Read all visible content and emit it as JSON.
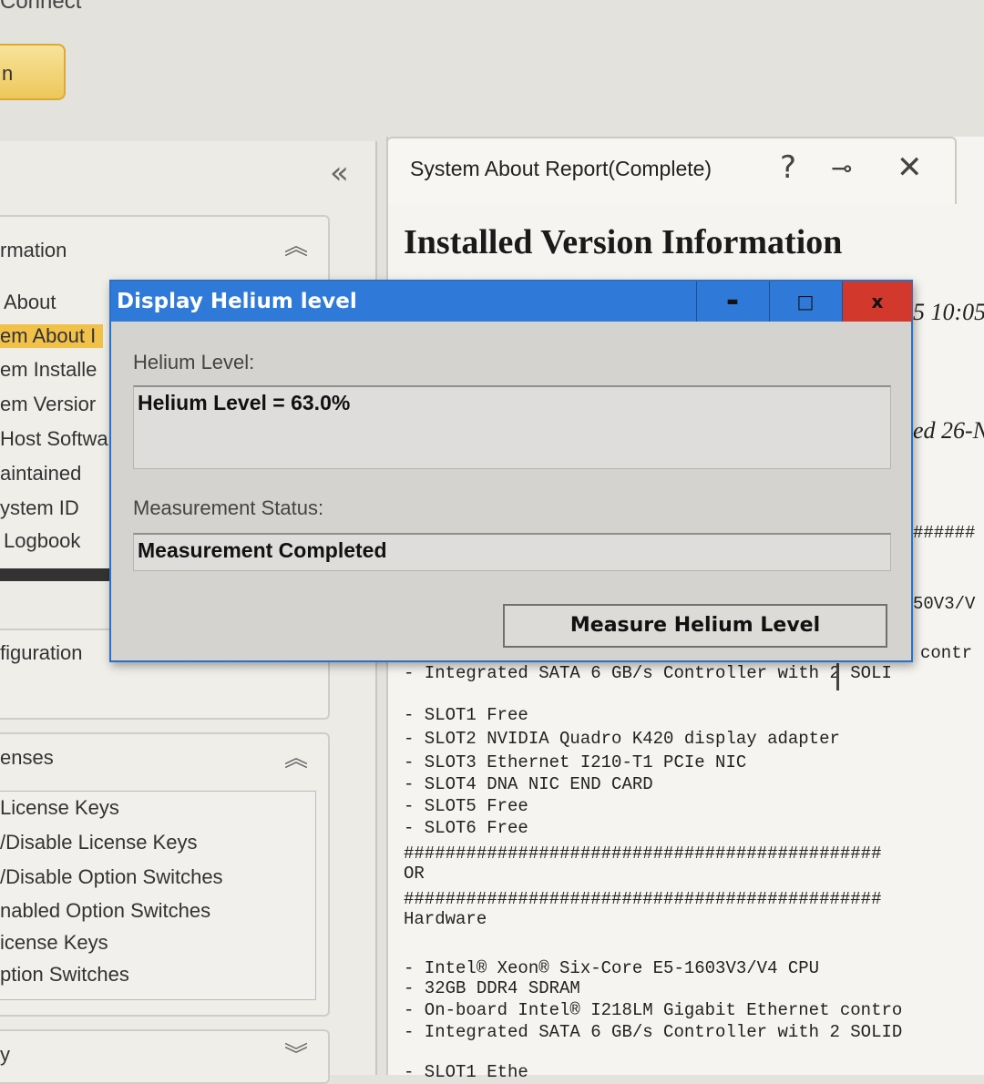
{
  "app": {
    "title": "Connect",
    "top_button_label": "n"
  },
  "sidebar": {
    "collapse_glyph": "«",
    "info_group": {
      "title": "rmation",
      "items": [
        {
          "label": "About"
        },
        {
          "label": "em About I"
        },
        {
          "label": "em Installe"
        },
        {
          "label": "em Versior"
        },
        {
          "label": "Host Softwa"
        },
        {
          "label": "aintained"
        },
        {
          "label": "ystem ID"
        },
        {
          "label": "Logbook"
        }
      ]
    },
    "config_group": {
      "title": "figuration"
    },
    "licenses_group": {
      "title": "enses",
      "items": [
        {
          "label": "License Keys"
        },
        {
          "label": "/Disable License Keys"
        },
        {
          "label": "/Disable Option Switches"
        },
        {
          "label": "nabled Option Switches"
        },
        {
          "label": "icense Keys"
        },
        {
          "label": "ption Switches"
        }
      ]
    },
    "bottom_group": {
      "title": "y"
    }
  },
  "report": {
    "tab_title": "System About Report(Complete)",
    "heading": "Installed Version Information",
    "edge_fragments": {
      "time": "5 10:05",
      "date": "ed 26-N",
      "hashes": "######",
      "cpu_fragment": "50V3/V",
      "contr_fragment": "contr",
      "sata_line": "- Integrated SATA 6 GB/s Controller with 2 SOLI"
    },
    "lines": [
      "- SLOT1 Free",
      "- SLOT2 NVIDIA Quadro K420 display adapter",
      "- SLOT3 Ethernet I210-T1 PCIe NIC",
      "- SLOT4 DNA NIC END CARD",
      "- SLOT5 Free",
      "- SLOT6 Free",
      "##############################################",
      "OR",
      "##############################################",
      "Hardware",
      "",
      "- Intel® Xeon® Six-Core E5-1603V3/V4 CPU",
      "- 32GB DDR4 SDRAM",
      "- On-board Intel® I218LM Gigabit Ethernet contro",
      "- Integrated SATA 6 GB/s Controller with 2 SOLID",
      "",
      "- SLOT1 Ethe"
    ]
  },
  "dialog": {
    "title": "Display Helium level",
    "minimize_glyph": "▬",
    "maximize_glyph": "□",
    "close_glyph": "x",
    "helium_label": "Helium Level:",
    "helium_value": "Helium Level = 63.0%",
    "status_label": "Measurement Status:",
    "status_value": "Measurement Completed",
    "measure_button": "Measure Helium Level"
  }
}
